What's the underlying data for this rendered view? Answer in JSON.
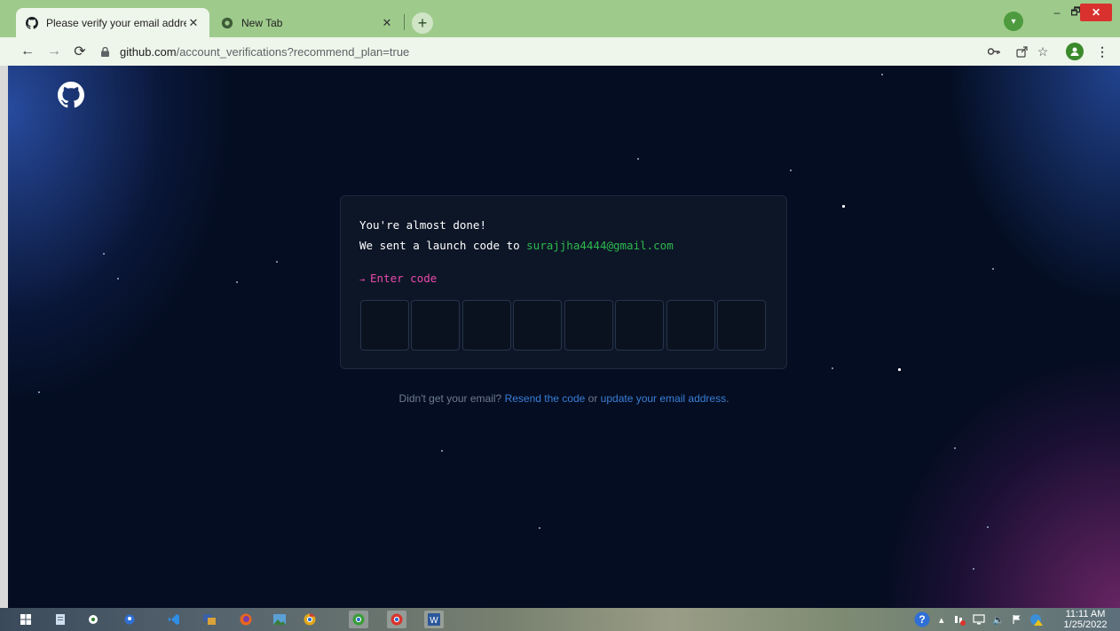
{
  "browser": {
    "tabs": [
      {
        "title": "Please verify your email address",
        "active": true
      },
      {
        "title": "New Tab",
        "active": false
      }
    ],
    "new_tab_symbol": "+",
    "url": {
      "host": "github.com",
      "path": "/account_verifications?recommend_plan=true"
    },
    "window_controls": {
      "minimize": "–",
      "maximize": "🗗",
      "close": "✕"
    }
  },
  "page": {
    "heading": "You're almost done!",
    "sent_text": "We sent a launch code to",
    "email": "surajjha4444@gmail.com",
    "prompt_arrow": "→",
    "prompt_label": "Enter code",
    "code_box_count": 8,
    "help": {
      "prefix": "Didn't get your email?",
      "resend_link": "Resend the code",
      "middle": "or",
      "update_link": "update your email address",
      "suffix": "."
    }
  },
  "taskbar": {
    "time": "11:11 AM",
    "date": "1/25/2022"
  },
  "icons": {
    "back": "back-arrow-icon",
    "forward": "forward-arrow-icon",
    "reload": "reload-icon",
    "lock": "lock-icon",
    "key": "key-icon",
    "share": "share-icon",
    "bookmark": "star-icon",
    "profile": "profile-icon",
    "menu": "kebab-menu-icon",
    "logo": "github-logo-icon"
  },
  "colors": {
    "email": "#2dba4e",
    "prompt": "#ea4aaa",
    "link": "#3a7fd8",
    "page_background": "#040d21",
    "tab_strip": "#9ecb8c"
  }
}
